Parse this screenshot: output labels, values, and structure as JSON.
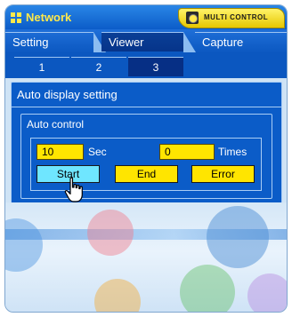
{
  "window": {
    "title": "Network",
    "badge": "MULTI CONTROL"
  },
  "tabs_main": [
    {
      "label": "Setting",
      "active": false
    },
    {
      "label": "Viewer",
      "active": true
    },
    {
      "label": "Capture",
      "active": false
    }
  ],
  "tabs_sub": [
    {
      "label": "1",
      "active": false
    },
    {
      "label": "2",
      "active": false
    },
    {
      "label": "3",
      "active": true
    }
  ],
  "section": {
    "title": "Auto display setting",
    "group_title": "Auto control",
    "interval_value": "10",
    "interval_unit": "Sec",
    "times_value": "0",
    "times_unit": "Times",
    "buttons": {
      "start": "Start",
      "end": "End",
      "error": "Error"
    }
  },
  "colors": {
    "title_text": "#ffe94a",
    "tab_bar": "#0b57c0",
    "field_bg": "#ffe500",
    "start_bg": "#6fe6ff"
  },
  "icons": {
    "title": "network-grid-icon",
    "badge": "projector-icon",
    "cursor": "hand-pointer-icon"
  }
}
